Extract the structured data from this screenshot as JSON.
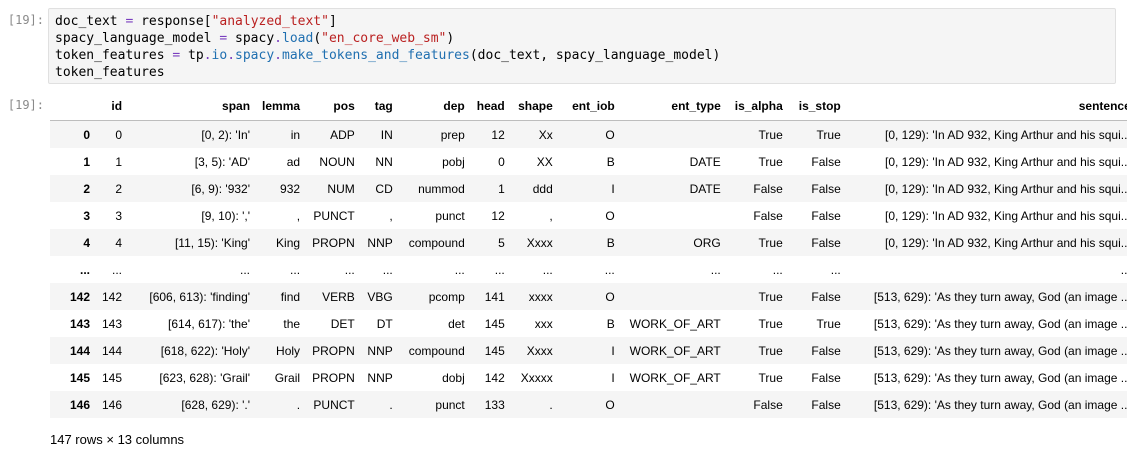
{
  "cells": {
    "input_prompt": "[19]:",
    "output_prompt": "[19]:",
    "code": {
      "line1_a": "doc_text ",
      "line1_op": "=",
      "line1_b": " response[",
      "line1_str": "\"analyzed_text\"",
      "line1_c": "]",
      "line2_a": "spacy_language_model ",
      "line2_op": "=",
      "line2_b": " spacy",
      "line2_dot": ".",
      "line2_attr": "load",
      "line2_c": "(",
      "line2_str": "\"en_core_web_sm\"",
      "line2_d": ")",
      "line3_a": "token_features ",
      "line3_op": "=",
      "line3_b": " tp",
      "line3_dot1": ".",
      "line3_attr1": "io",
      "line3_dot2": ".",
      "line3_attr2": "spacy",
      "line3_dot3": ".",
      "line3_attr3": "make_tokens_and_features",
      "line3_c": "(doc_text, spacy_language_model)",
      "line4": "token_features"
    }
  },
  "table": {
    "columns": [
      "",
      "id",
      "span",
      "lemma",
      "pos",
      "tag",
      "dep",
      "head",
      "shape",
      "ent_iob",
      "ent_type",
      "is_alpha",
      "is_stop",
      "sentence"
    ],
    "rows": [
      [
        "0",
        "0",
        "[0, 2): 'In'",
        "in",
        "ADP",
        "IN",
        "prep",
        "12",
        "Xx",
        "O",
        "",
        "True",
        "True",
        "[0, 129): 'In AD 932, King Arthur and his squi..."
      ],
      [
        "1",
        "1",
        "[3, 5): 'AD'",
        "ad",
        "NOUN",
        "NN",
        "pobj",
        "0",
        "XX",
        "B",
        "DATE",
        "True",
        "False",
        "[0, 129): 'In AD 932, King Arthur and his squi..."
      ],
      [
        "2",
        "2",
        "[6, 9): '932'",
        "932",
        "NUM",
        "CD",
        "nummod",
        "1",
        "ddd",
        "I",
        "DATE",
        "False",
        "False",
        "[0, 129): 'In AD 932, King Arthur and his squi..."
      ],
      [
        "3",
        "3",
        "[9, 10): ','",
        ",",
        "PUNCT",
        ",",
        "punct",
        "12",
        ",",
        "O",
        "",
        "False",
        "False",
        "[0, 129): 'In AD 932, King Arthur and his squi..."
      ],
      [
        "4",
        "4",
        "[11, 15): 'King'",
        "King",
        "PROPN",
        "NNP",
        "compound",
        "5",
        "Xxxx",
        "B",
        "ORG",
        "True",
        "False",
        "[0, 129): 'In AD 932, King Arthur and his squi..."
      ],
      [
        "...",
        "...",
        "...",
        "...",
        "...",
        "...",
        "...",
        "...",
        "...",
        "...",
        "...",
        "...",
        "...",
        "..."
      ],
      [
        "142",
        "142",
        "[606, 613): 'finding'",
        "find",
        "VERB",
        "VBG",
        "pcomp",
        "141",
        "xxxx",
        "O",
        "",
        "True",
        "False",
        "[513, 629): 'As they turn away, God (an image ..."
      ],
      [
        "143",
        "143",
        "[614, 617): 'the'",
        "the",
        "DET",
        "DT",
        "det",
        "145",
        "xxx",
        "B",
        "WORK_OF_ART",
        "True",
        "True",
        "[513, 629): 'As they turn away, God (an image ..."
      ],
      [
        "144",
        "144",
        "[618, 622): 'Holy'",
        "Holy",
        "PROPN",
        "NNP",
        "compound",
        "145",
        "Xxxx",
        "I",
        "WORK_OF_ART",
        "True",
        "False",
        "[513, 629): 'As they turn away, God (an image ..."
      ],
      [
        "145",
        "145",
        "[623, 628): 'Grail'",
        "Grail",
        "PROPN",
        "NNP",
        "dobj",
        "142",
        "Xxxxx",
        "I",
        "WORK_OF_ART",
        "True",
        "False",
        "[513, 629): 'As they turn away, God (an image ..."
      ],
      [
        "146",
        "146",
        "[628, 629): '.'",
        ".",
        "PUNCT",
        ".",
        "punct",
        "133",
        ".",
        "O",
        "",
        "False",
        "False",
        "[513, 629): 'As they turn away, God (an image ..."
      ]
    ],
    "footer": "147 rows × 13 columns"
  }
}
